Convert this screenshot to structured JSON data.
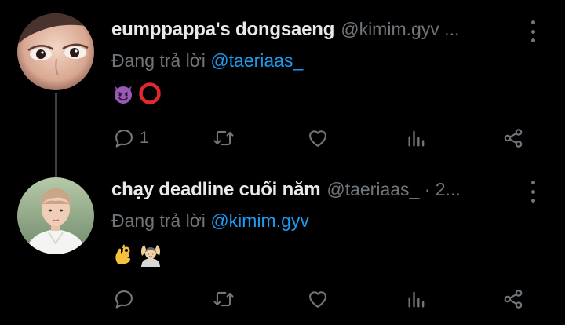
{
  "tweets": [
    {
      "display_name": "eumppappa's dongsaeng",
      "handle": "@kimim.gyv ...",
      "reply_label": "Đang trả lời",
      "reply_mention": "@taeriaas_",
      "content_emojis": [
        "smiling-imp-emoji",
        "red-circle-emoji"
      ],
      "reply_count": "1",
      "retweet_count": "",
      "like_count": ""
    },
    {
      "display_name": "chạy deadline cuối năm",
      "handle": "@taeriaas_ · 2...",
      "reply_label": "Đang trả lời",
      "reply_mention": "@kimim.gyv",
      "content_emojis": [
        "ok-hand-emoji",
        "person-gesturing-ok-emoji"
      ],
      "reply_count": "",
      "retweet_count": "",
      "like_count": ""
    }
  ],
  "colors": {
    "background": "#000000",
    "text_primary": "#e7e9ea",
    "text_secondary": "#71767b",
    "accent": "#1d9bf0",
    "thread_line": "#3b4045"
  },
  "icons": [
    "reply-icon",
    "retweet-icon",
    "like-icon",
    "views-icon",
    "share-icon",
    "more-icon"
  ]
}
